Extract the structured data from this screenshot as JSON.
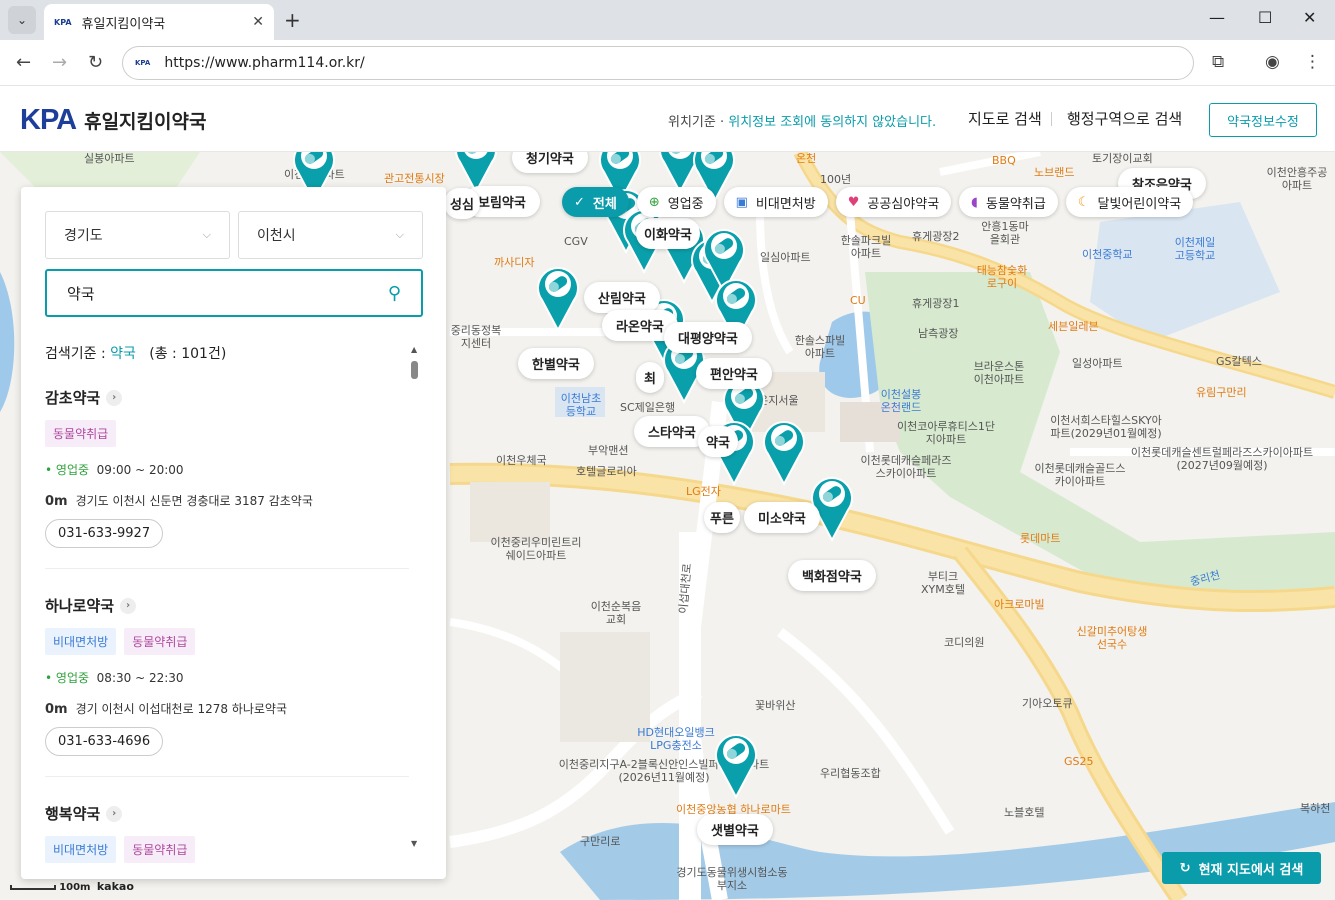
{
  "browser": {
    "tab_title": "휴일지킴이약국",
    "tab_favicon": "KPA",
    "url": "https://www.pharm114.or.kr/",
    "url_favicon": "KPA"
  },
  "header": {
    "logo_kpa_1": "K",
    "logo_kpa_2": "PA",
    "logo_text": "휴일지킴이약국",
    "loc_prefix": "위치기준 · ",
    "loc_status": "위치정보 조회에 동의하지 않았습니다.",
    "nav_map": "지도로 검색",
    "nav_region": "행정구역으로 검색",
    "edit_button": "약국정보수정"
  },
  "filters": [
    {
      "label": "전체",
      "icon": "check-icon"
    },
    {
      "label": "영업중",
      "icon": "plus-circle-icon"
    },
    {
      "label": "비대면처방",
      "icon": "monitor-icon"
    },
    {
      "label": "공공심야약국",
      "icon": "heart-icon"
    },
    {
      "label": "동물약취급",
      "icon": "capsule-icon"
    },
    {
      "label": "달빛어린이약국",
      "icon": "moon-icon"
    }
  ],
  "panel": {
    "province": "경기도",
    "city": "이천시",
    "search_value": "약국",
    "summary_prefix": "검색기준 : ",
    "summary_keyword": "약국",
    "summary_total": "(총 : 101건)",
    "items": [
      {
        "name": "감초약국",
        "tags": [
          "동물약취급"
        ],
        "status": "영업중",
        "hours": "09:00 ~ 20:00",
        "distance": "0m",
        "address": "경기도 이천시 신둔면 경충대로 3187 감초약국",
        "phone": "031-633-9927"
      },
      {
        "name": "하나로약국",
        "tags": [
          "비대면처방",
          "동물약취급"
        ],
        "status": "영업중",
        "hours": "08:30 ~ 22:30",
        "distance": "0m",
        "address": "경기 이천시 이섭대천로 1278 하나로약국",
        "phone": "031-633-4696"
      },
      {
        "name": "행복약국",
        "tags": [
          "비대면처방",
          "동물약취급"
        ]
      }
    ]
  },
  "map": {
    "research_button": "현재 지도에서 검색",
    "scale_label": "100m",
    "provider": "kakao",
    "pharmacy_labels": [
      "보림약국",
      "산림약국",
      "라온약국",
      "대평양약국",
      "한별약국",
      "편안약국",
      "스타약국",
      "미소약국",
      "백화점약국",
      "샛별약국",
      "참조은약국",
      "이화약국",
      "청기약국",
      "푸른",
      "최",
      "약국",
      "성심"
    ],
    "place_labels": [
      "실봉아파트",
      "이천선아파트",
      "관고전통시장",
      "온천",
      "토기장이교회",
      "이천안흥주공아파트",
      "100년",
      "BBQ",
      "노브랜드",
      "CGV",
      "까사디자",
      "한솔파크빌아파트",
      "일심아파트",
      "휴게광장2",
      "안흥1동마을회관",
      "이천중학교",
      "이천제일고등학교",
      "CU",
      "휴게광장1",
      "남측광장",
      "태능참숯화로구이",
      "세븐일레븐",
      "중리동정복지센터",
      "한솔스파빌아파트",
      "브라운스톤이천아파트",
      "일성아파트",
      "GS칼텍스",
      "이천설봉온천랜드",
      "유림구만리",
      "이천남초등학교",
      "SC제일은행",
      "라온지서울",
      "이천코아루휴티스1단지아파트",
      "이천서희스타힐스SKY아파트(2029년01월예정)",
      "부악맨션",
      "이천롯데캐슬센트럴페라즈스카이아파트(2027년09월예정)",
      "이천우체국",
      "호텔글로리아",
      "이천롯데캐슬페라즈스카이아파트",
      "이천롯데캐슬골드스카이아파트",
      "LG전자",
      "이천중리우미린트리쉐이드아파트",
      "부티크XYM호텔",
      "롯데마트",
      "이천순복음교회",
      "아크로마빌",
      "코디의원",
      "신갈미추어탕생선국수",
      "꽃바위산",
      "기아오토큐",
      "HD현대오일뱅크LPG충전소",
      "이천중리지구A-2블록신안인스빌퍼스트아파트(2026년11월예정)",
      "우리협동조합",
      "GS25",
      "노블호텔",
      "이천중앙농협 하나로마트",
      "구만리로",
      "경기도동물위생시험소동부지소",
      "복하천",
      "중리천",
      "이섭대천로"
    ]
  },
  "colors": {
    "accent": "#0a9cab",
    "brand_blue": "#1e3f99",
    "open_green": "#2fa33c",
    "vet_tag": "#b0489e",
    "rx_tag": "#3a7bd5"
  }
}
